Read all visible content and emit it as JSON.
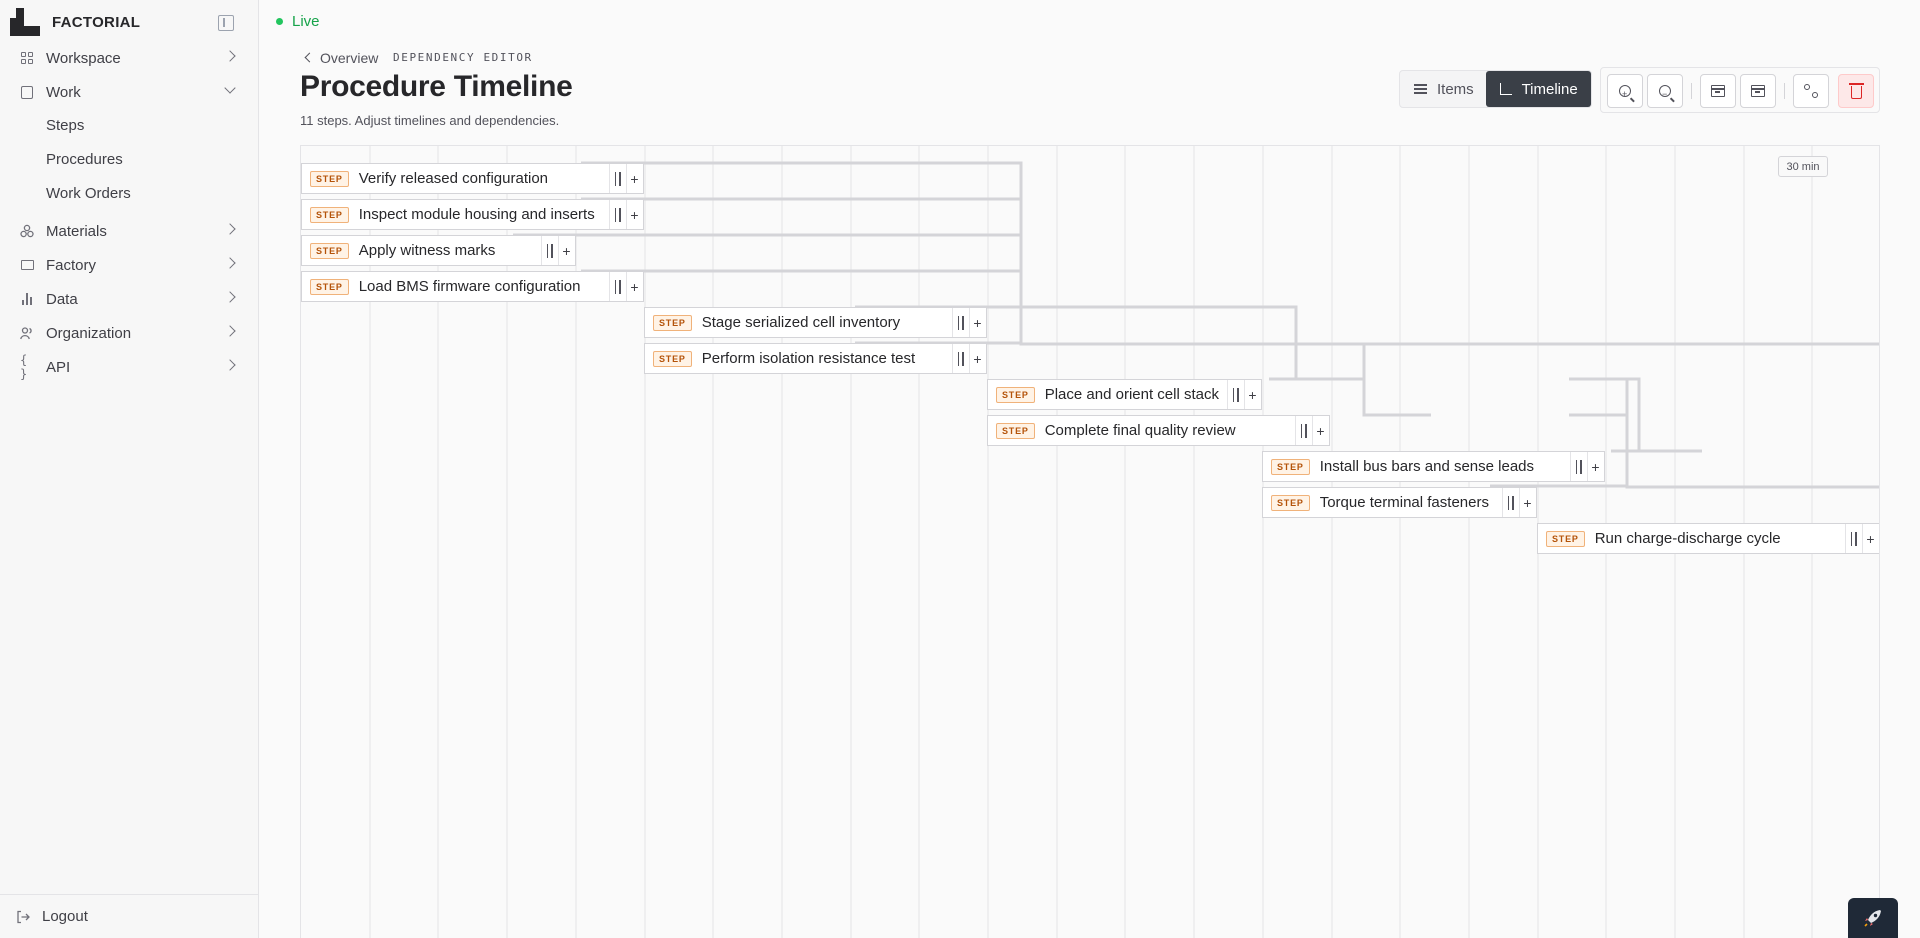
{
  "app": {
    "name": "FACTORIAL"
  },
  "status": {
    "label": "Live"
  },
  "nav": {
    "items": [
      {
        "label": "Workspace"
      },
      {
        "label": "Work"
      },
      {
        "label": "Materials"
      },
      {
        "label": "Factory"
      },
      {
        "label": "Data"
      },
      {
        "label": "Organization"
      },
      {
        "label": "API"
      }
    ],
    "work_sub": [
      {
        "label": "Steps"
      },
      {
        "label": "Procedures"
      },
      {
        "label": "Work Orders"
      }
    ],
    "logout": "Logout"
  },
  "header": {
    "breadcrumb": "Overview",
    "tag": "DEPENDENCY EDITOR",
    "title": "Procedure Timeline",
    "subtitle": "11 steps. Adjust timelines and dependencies."
  },
  "view_toggle": {
    "items": "Items",
    "timeline": "Timeline",
    "active": "Timeline"
  },
  "timeline": {
    "scale": "30 min",
    "badge": "STEP",
    "steps": [
      {
        "label": "Verify released configuration"
      },
      {
        "label": "Inspect module housing and inserts"
      },
      {
        "label": "Apply witness marks"
      },
      {
        "label": "Load BMS firmware configuration"
      },
      {
        "label": "Stage serialized cell inventory"
      },
      {
        "label": "Perform isolation resistance test"
      },
      {
        "label": "Place and orient cell stack"
      },
      {
        "label": "Complete final quality review"
      },
      {
        "label": "Install bus bars and sense leads"
      },
      {
        "label": "Torque terminal fasteners"
      },
      {
        "label": "Run charge-discharge cycle"
      }
    ]
  },
  "colors": {
    "accent_dark": "#3a3f47",
    "live": "#16a34a",
    "badge": "#b45309",
    "danger": "#dc2626"
  },
  "icons": {
    "workspace": "grid-icon",
    "work": "clipboard-icon",
    "materials": "boxes-icon",
    "factory": "folder-icon",
    "data": "bar-chart-icon",
    "organization": "users-icon",
    "api": "braces-icon",
    "logout": "logout-icon"
  }
}
